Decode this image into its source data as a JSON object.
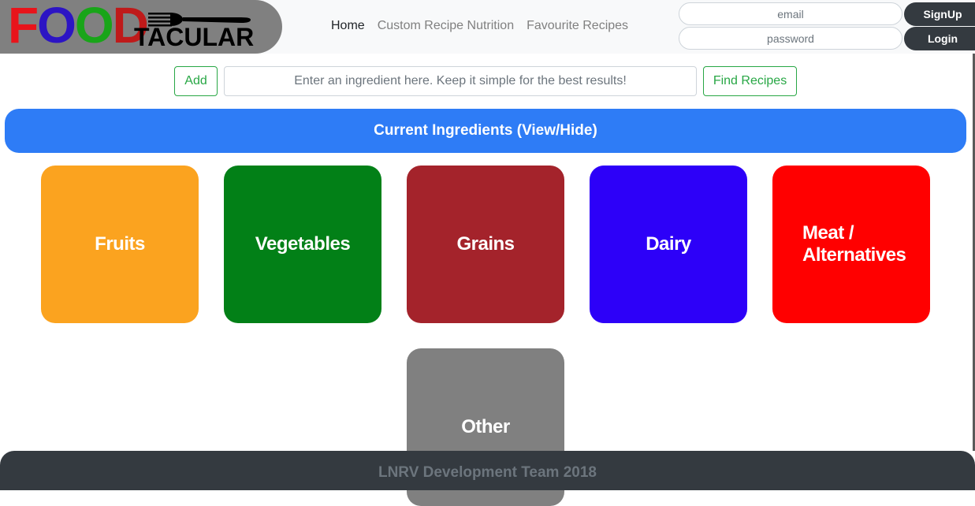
{
  "logo": {
    "letters": [
      {
        "char": "F",
        "color": "#e8141b"
      },
      {
        "char": "O",
        "color": "#2c14c4"
      },
      {
        "char": "O",
        "color": "#19a519"
      },
      {
        "char": "D",
        "color": "#bf1a1a"
      }
    ],
    "suffix": "TACULAR",
    "icon": "fork-icon"
  },
  "nav": {
    "items": [
      {
        "label": "Home",
        "active": true
      },
      {
        "label": "Custom Recipe Nutrition",
        "active": false
      },
      {
        "label": "Favourite Recipes",
        "active": false
      }
    ]
  },
  "auth": {
    "email_placeholder": "email",
    "password_placeholder": "password",
    "signup_label": "SignUp",
    "login_label": "Login"
  },
  "search": {
    "add_label": "Add",
    "placeholder": "Enter an ingredient here. Keep it simple for the best results!",
    "find_label": "Find Recipes"
  },
  "current_ingredients": {
    "label": "Current Ingredients (View/Hide)"
  },
  "categories": [
    {
      "label": "Fruits",
      "color": "#fba31f"
    },
    {
      "label": "Vegetables",
      "color": "#028017"
    },
    {
      "label": "Grains",
      "color": "#a4232b"
    },
    {
      "label": "Dairy",
      "color": "#2d00f8"
    },
    {
      "label": "Meat / Alternatives",
      "color": "#ff0000"
    },
    {
      "label": "Other",
      "color": "#808080"
    }
  ],
  "footer": {
    "text": "LNRV Development Team 2018"
  }
}
